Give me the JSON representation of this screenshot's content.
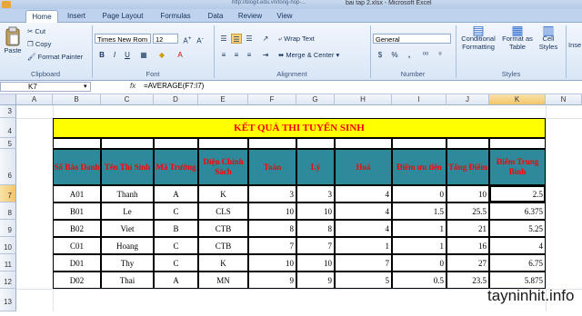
{
  "window": {
    "title": "bai tap 2.xlsx - Microsoft Excel",
    "url_hint": "http://blogit.edu.vn/tong-hop-..."
  },
  "ribbon_tabs": [
    {
      "label": "Home",
      "active": true
    },
    {
      "label": "Insert"
    },
    {
      "label": "Page Layout"
    },
    {
      "label": "Formulas"
    },
    {
      "label": "Data"
    },
    {
      "label": "Review"
    },
    {
      "label": "View"
    }
  ],
  "clipboard": {
    "paste": "Paste",
    "cut": "Cut",
    "copy": "Copy",
    "format_painter": "Format Painter",
    "label": "Clipboard"
  },
  "font": {
    "name": "Times New Rom",
    "size": "12",
    "label": "Font",
    "bold": "B",
    "italic": "I",
    "underline": "U"
  },
  "alignment": {
    "wrap_text": "Wrap Text",
    "merge_center": "Merge & Center",
    "label": "Alignment"
  },
  "number": {
    "format": "General",
    "label": "Number",
    "currency": "$",
    "percent": "%",
    "comma": ","
  },
  "styles": {
    "conditional": "Conditional Formatting",
    "format_table": "Format as Table",
    "cell_styles": "Cell Styles",
    "label": "Styles",
    "insert": "Inse"
  },
  "formula_bar": {
    "name_box": "K7",
    "fx": "fx",
    "formula": "=AVERAGE(F7:I7)"
  },
  "columns": [
    "A",
    "B",
    "C",
    "D",
    "E",
    "F",
    "G",
    "H",
    "I",
    "J",
    "K",
    "N"
  ],
  "rows": [
    "3",
    "4",
    "5",
    "6",
    "7",
    "8",
    "9",
    "10",
    "11",
    "12",
    "13"
  ],
  "sheet": {
    "title": "KẾT QUẢ THI TUYỂN SINH",
    "headers": [
      "Số Báo Danh",
      "Tên Thí Sinh",
      "Mã Trường",
      "Diện Chính Sách",
      "Toán",
      "Lý",
      "Hoá",
      "Điểm ưu tiên",
      "Tổng Điểm",
      "Điểm Trung Bình"
    ],
    "data": [
      [
        "A01",
        "Thanh",
        "A",
        "K",
        "3",
        "3",
        "4",
        "0",
        "10",
        "2.5"
      ],
      [
        "B01",
        "Le",
        "C",
        "CLS",
        "10",
        "10",
        "4",
        "1.5",
        "25.5",
        "6.375"
      ],
      [
        "B02",
        "Viet",
        "B",
        "CTB",
        "8",
        "8",
        "4",
        "1",
        "21",
        "5.25"
      ],
      [
        "C01",
        "Hoang",
        "C",
        "CTB",
        "7",
        "7",
        "1",
        "1",
        "16",
        "4"
      ],
      [
        "D01",
        "Thy",
        "C",
        "K",
        "10",
        "10",
        "7",
        "0",
        "27",
        "6.75"
      ],
      [
        "D02",
        "Thai",
        "A",
        "MN",
        "9",
        "9",
        "5",
        "0.5",
        "23.5",
        "5.875"
      ]
    ]
  },
  "watermark": "tayninhit.info",
  "colors": {
    "title_bg": "#ffff00",
    "title_text": "#ff0000",
    "header_bg": "#2e8a9a",
    "header_text": "#ff0000"
  }
}
